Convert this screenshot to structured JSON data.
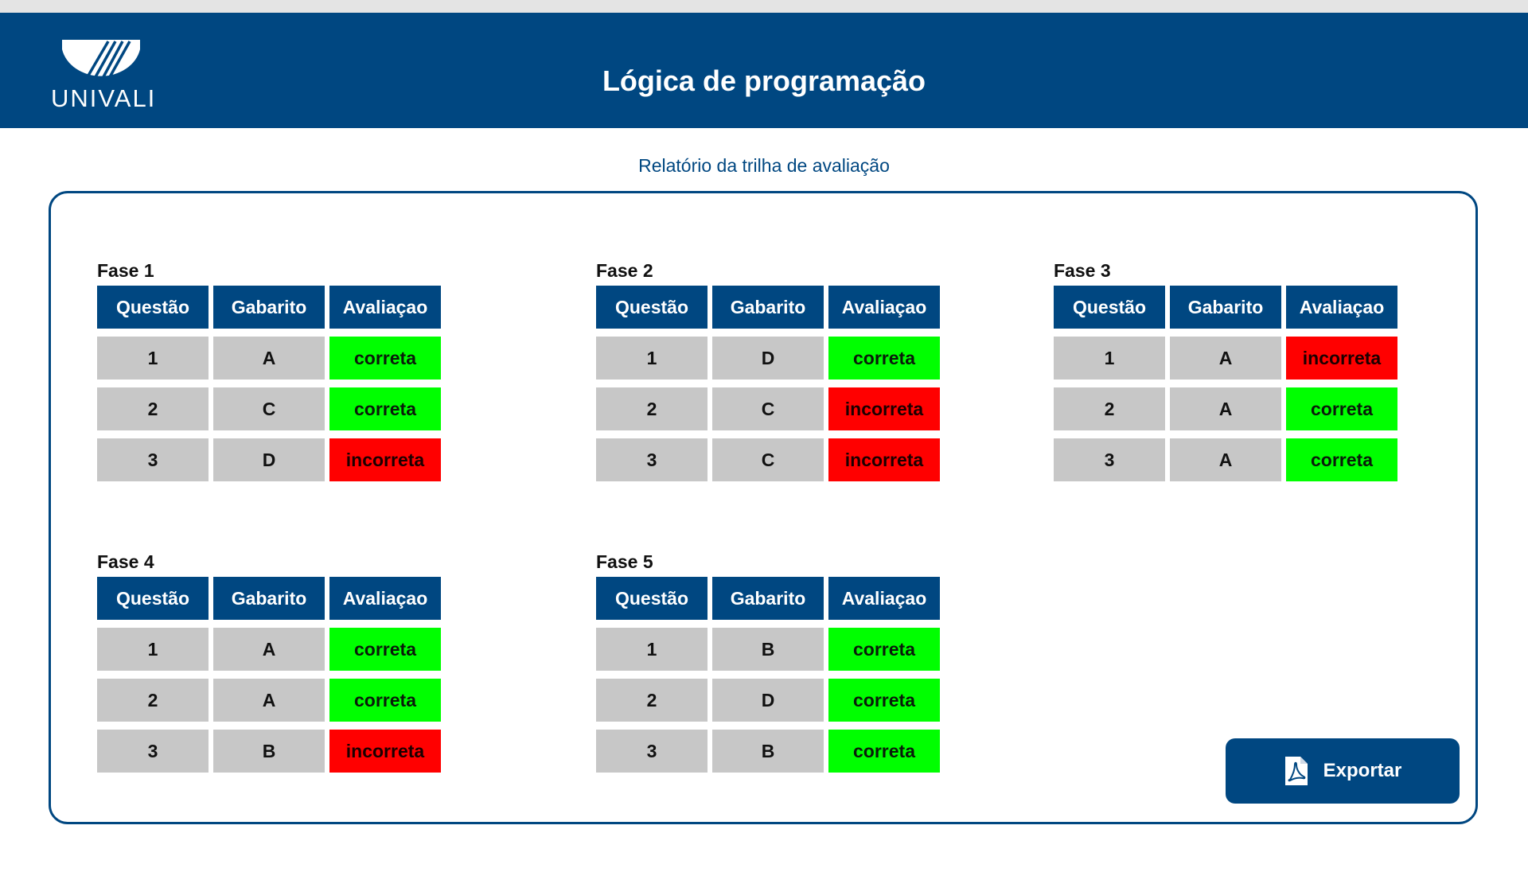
{
  "app": {
    "title": "Lógica de programação",
    "logo_text": "UNIVALI"
  },
  "report": {
    "subtitle": "Relatório da trilha de avaliação"
  },
  "columns": [
    "Questão",
    "Gabarito",
    "Avaliaçao"
  ],
  "phases": [
    {
      "title": "Fase 1",
      "rows": [
        {
          "q": "1",
          "g": "A",
          "a": "correta"
        },
        {
          "q": "2",
          "g": "C",
          "a": "correta"
        },
        {
          "q": "3",
          "g": "D",
          "a": "incorreta"
        }
      ]
    },
    {
      "title": "Fase 2",
      "rows": [
        {
          "q": "1",
          "g": "D",
          "a": "correta"
        },
        {
          "q": "2",
          "g": "C",
          "a": "incorreta"
        },
        {
          "q": "3",
          "g": "C",
          "a": "incorreta"
        }
      ]
    },
    {
      "title": "Fase 3",
      "rows": [
        {
          "q": "1",
          "g": "A",
          "a": "incorreta"
        },
        {
          "q": "2",
          "g": "A",
          "a": "correta"
        },
        {
          "q": "3",
          "g": "A",
          "a": "correta"
        }
      ]
    },
    {
      "title": "Fase 4",
      "rows": [
        {
          "q": "1",
          "g": "A",
          "a": "correta"
        },
        {
          "q": "2",
          "g": "A",
          "a": "correta"
        },
        {
          "q": "3",
          "g": "B",
          "a": "incorreta"
        }
      ]
    },
    {
      "title": "Fase 5",
      "rows": [
        {
          "q": "1",
          "g": "B",
          "a": "correta"
        },
        {
          "q": "2",
          "g": "D",
          "a": "correta"
        },
        {
          "q": "3",
          "g": "B",
          "a": "correta"
        }
      ]
    }
  ],
  "export": {
    "label": "Exportar",
    "icon": "pdf-file-icon"
  },
  "colors": {
    "brand": "#004781",
    "correct": "#00ff00",
    "incorrect": "#ff0000",
    "cell": "#c7c7c7"
  }
}
